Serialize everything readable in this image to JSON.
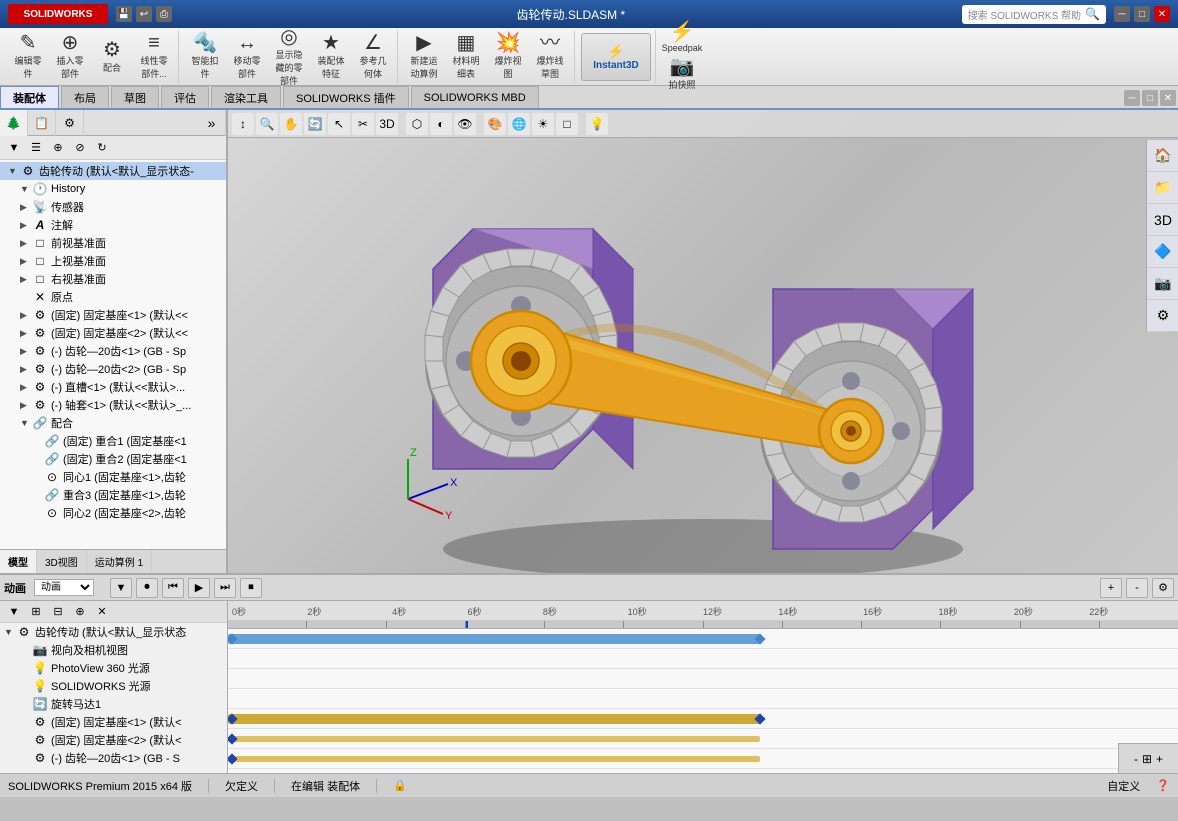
{
  "titlebar": {
    "logo": "SOLIDWORKS",
    "title": "齿轮传动.SLDASM *",
    "search_placeholder": "搜索 SOLIDWORKS 帮助"
  },
  "toolbar": {
    "groups": [
      {
        "buttons": [
          {
            "icon": "✎",
            "label": "编辑零件"
          },
          {
            "icon": "⊕",
            "label": "插入零件"
          },
          {
            "icon": "⚙",
            "label": "配合"
          },
          {
            "icon": "≡",
            "label": "线性零件..."
          }
        ]
      },
      {
        "buttons": [
          {
            "icon": "⊞",
            "label": "智能扣件"
          },
          {
            "icon": "↔",
            "label": "移动零部件"
          },
          {
            "icon": "◉",
            "label": "显示隐藏的零部件"
          },
          {
            "icon": "★",
            "label": "装配体特征"
          },
          {
            "icon": "∠",
            "label": "参考几何体"
          }
        ]
      },
      {
        "buttons": [
          {
            "icon": "▶",
            "label": "新建运动算例"
          },
          {
            "icon": "▦",
            "label": "材料明细表"
          },
          {
            "icon": "💥",
            "label": "爆炸视图"
          },
          {
            "icon": "〰",
            "label": "爆炸线草图"
          }
        ]
      },
      {
        "special": "instant3d",
        "label": "Instant3D"
      },
      {
        "buttons": [
          {
            "icon": "⚡",
            "label": "Speedpak"
          }
        ]
      },
      {
        "buttons": [
          {
            "icon": "📷",
            "label": "拍快照"
          }
        ]
      }
    ]
  },
  "tabs": {
    "main": [
      "装配体",
      "布局",
      "草图",
      "评估",
      "渲染工具",
      "SOLIDWORKS 插件",
      "SOLIDWORKS MBD"
    ],
    "active": "装配体"
  },
  "left_panel": {
    "tree_title": "齿轮传动 (默认<默认_显示状态-",
    "tree_items": [
      {
        "level": 0,
        "expanded": true,
        "icon": "🔧",
        "label": "齿轮传动 (默认<默认_显示状态-",
        "type": "root"
      },
      {
        "level": 1,
        "expanded": true,
        "icon": "🕐",
        "label": "History",
        "type": "history"
      },
      {
        "level": 1,
        "expanded": false,
        "icon": "📡",
        "label": "传感器",
        "type": "sensor"
      },
      {
        "level": 1,
        "expanded": false,
        "icon": "A",
        "label": "注解",
        "type": "annotation"
      },
      {
        "level": 1,
        "expanded": false,
        "icon": "□",
        "label": "前视基准面",
        "type": "plane"
      },
      {
        "level": 1,
        "expanded": false,
        "icon": "□",
        "label": "上视基准面",
        "type": "plane"
      },
      {
        "level": 1,
        "expanded": false,
        "icon": "□",
        "label": "右视基准面",
        "type": "plane"
      },
      {
        "level": 1,
        "expanded": false,
        "icon": "✕",
        "label": "原点",
        "type": "origin"
      },
      {
        "level": 1,
        "expanded": false,
        "icon": "⚙",
        "label": "(固定) 固定基座<1> (默认<<",
        "type": "part"
      },
      {
        "level": 1,
        "expanded": false,
        "icon": "⚙",
        "label": "(固定) 固定基座<2> (默认<<",
        "type": "part"
      },
      {
        "level": 1,
        "expanded": false,
        "icon": "⚙",
        "label": "(-) 齿轮—20齿<1> (GB - Sp",
        "type": "part"
      },
      {
        "level": 1,
        "expanded": false,
        "icon": "⚙",
        "label": "(-) 齿轮—20齿<2> (GB - Sp",
        "type": "part"
      },
      {
        "level": 1,
        "expanded": false,
        "icon": "⚙",
        "label": "(-) 直槽<1> (默认<<默认>...",
        "type": "part"
      },
      {
        "level": 1,
        "expanded": false,
        "icon": "⚙",
        "label": "(-) 轴套<1> (默认<<默认>_...",
        "type": "part"
      },
      {
        "level": 1,
        "expanded": true,
        "icon": "🔗",
        "label": "配合",
        "type": "mates"
      },
      {
        "level": 2,
        "expanded": false,
        "icon": "🔗",
        "label": "(固定) 重合1 (固定基座<1",
        "type": "mate"
      },
      {
        "level": 2,
        "expanded": false,
        "icon": "🔗",
        "label": "(固定) 重合2 (固定基座<1",
        "type": "mate"
      },
      {
        "level": 2,
        "expanded": false,
        "icon": "⊙",
        "label": "同心1 (固定基座<1>,齿轮",
        "type": "mate"
      },
      {
        "level": 2,
        "expanded": false,
        "icon": "🔗",
        "label": "重合3 (固定基座<1>,齿轮",
        "type": "mate"
      },
      {
        "level": 2,
        "expanded": false,
        "icon": "⊙",
        "label": "同心2 (固定基座<2>,齿轮",
        "type": "mate"
      }
    ],
    "bottom_tabs": [
      "模型",
      "3D视图",
      "运动算例 1"
    ],
    "active_bottom_tab": "模型"
  },
  "animation": {
    "label": "动画",
    "controls": [
      "⏮",
      "⏭",
      "▶",
      "⏸",
      "⏹"
    ],
    "tree_items": [
      {
        "level": 0,
        "expanded": true,
        "icon": "⚙",
        "label": "齿轮传动 (默认<默认_显示状态"
      },
      {
        "level": 1,
        "expanded": false,
        "icon": "📷",
        "label": "视向及相机视图"
      },
      {
        "level": 1,
        "expanded": false,
        "icon": "💡",
        "label": "PhotoView 360 光源"
      },
      {
        "level": 1,
        "expanded": false,
        "icon": "💡",
        "label": "SOLIDWORKS 光源"
      },
      {
        "level": 1,
        "expanded": false,
        "icon": "🔄",
        "label": "旋转马达1"
      },
      {
        "level": 1,
        "expanded": false,
        "icon": "⚙",
        "label": "(固定) 固定基座<1> (默认<"
      },
      {
        "level": 1,
        "expanded": false,
        "icon": "⚙",
        "label": "(固定) 固定基座<2> (默认<"
      },
      {
        "level": 1,
        "expanded": false,
        "icon": "⚙",
        "label": "(-) 齿轮—20齿<1> (GB - S"
      }
    ],
    "ruler_marks": [
      "0秒",
      "2秒",
      "4秒",
      "6秒",
      "8秒",
      "10秒",
      "12秒",
      "14秒",
      "16秒",
      "18秒",
      "20秒",
      "22秒"
    ],
    "timeline_bars": [
      {
        "row": 0,
        "start_pct": 0,
        "width_pct": 55,
        "color": "#4488cc",
        "type": "bar"
      },
      {
        "row": 3,
        "start_pct": 0,
        "width_pct": 55,
        "color": "#c8a020",
        "type": "bar"
      },
      {
        "row": 4,
        "start_pct": 0,
        "width_pct": 55,
        "color": "#c8a020",
        "type": "bar"
      },
      {
        "row": 5,
        "start_pct": 0,
        "width_pct": 55,
        "color": "#c8a020",
        "type": "bar"
      },
      {
        "row": 6,
        "start_pct": 0,
        "width_pct": 55,
        "color": "#c8a020",
        "type": "bar"
      }
    ]
  },
  "status_bar": {
    "left": "SOLIDWORKS Premium 2015 x64 版",
    "status1": "欠定义",
    "status2": "在编辑 装配体",
    "status3": "自定义",
    "icon": "🔒"
  },
  "viewport": {
    "toolbar_buttons": [
      "↕",
      "🔍",
      "🔭",
      "✂",
      "🔄",
      "📐",
      "⬡",
      "⬢",
      "∿",
      "⊕",
      "◐",
      "🌐",
      "☀",
      "⬜",
      "💡"
    ]
  }
}
